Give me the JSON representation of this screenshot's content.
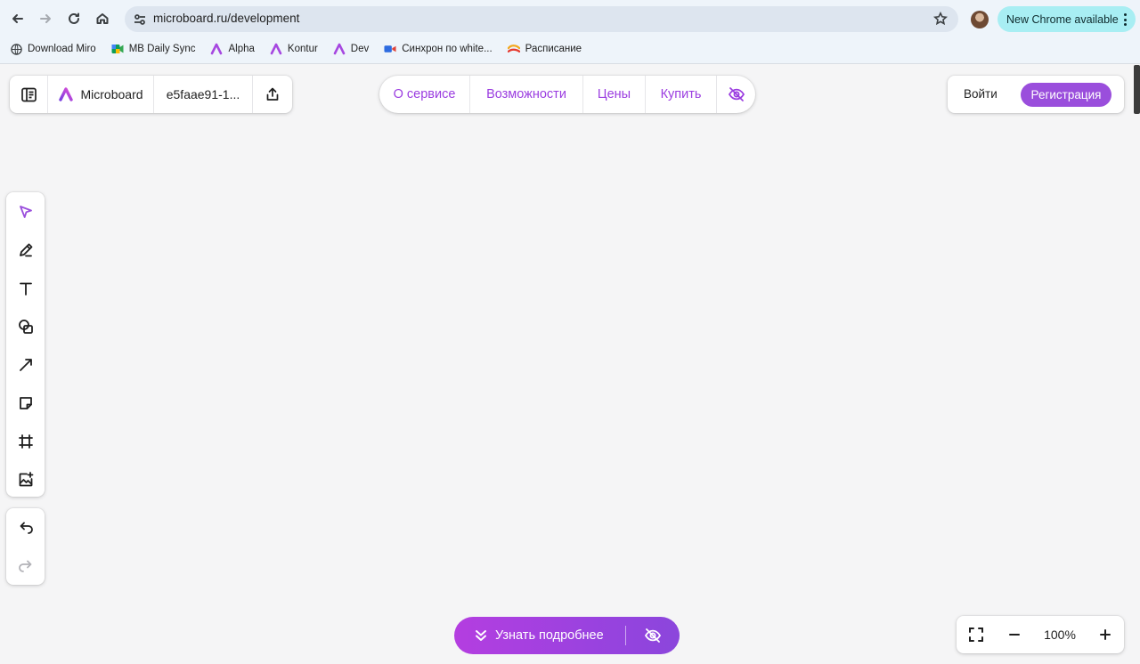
{
  "browser": {
    "url": "microboard.ru/development",
    "update_label": "New Chrome available",
    "bookmarks": [
      {
        "label": "Download Miro",
        "icon": "globe-icon"
      },
      {
        "label": "MB Daily Sync",
        "icon": "meet-icon"
      },
      {
        "label": "Alpha",
        "icon": "microboard-icon"
      },
      {
        "label": "Kontur",
        "icon": "microboard-icon"
      },
      {
        "label": "Dev",
        "icon": "microboard-icon"
      },
      {
        "label": "Синхрон по white...",
        "icon": "video-icon"
      },
      {
        "label": "Расписание",
        "icon": "calendar-logo-icon"
      }
    ]
  },
  "board": {
    "app_name": "Microboard",
    "board_id": "e5faae91-1..."
  },
  "nav": {
    "items": [
      "О сервисе",
      "Возможности",
      "Цены",
      "Купить"
    ]
  },
  "auth": {
    "login": "Войти",
    "signup": "Регистрация"
  },
  "tools": [
    "select",
    "pen",
    "text",
    "shapes",
    "connector",
    "sticker",
    "frame",
    "image"
  ],
  "promo": {
    "label": "Узнать подробнее"
  },
  "zoom": {
    "value": "100%"
  },
  "colors": {
    "accent": "#9a4edc",
    "nav_text": "#9b3de0",
    "canvas": "#f5f5f6",
    "update_chip": "#a8eef3"
  }
}
